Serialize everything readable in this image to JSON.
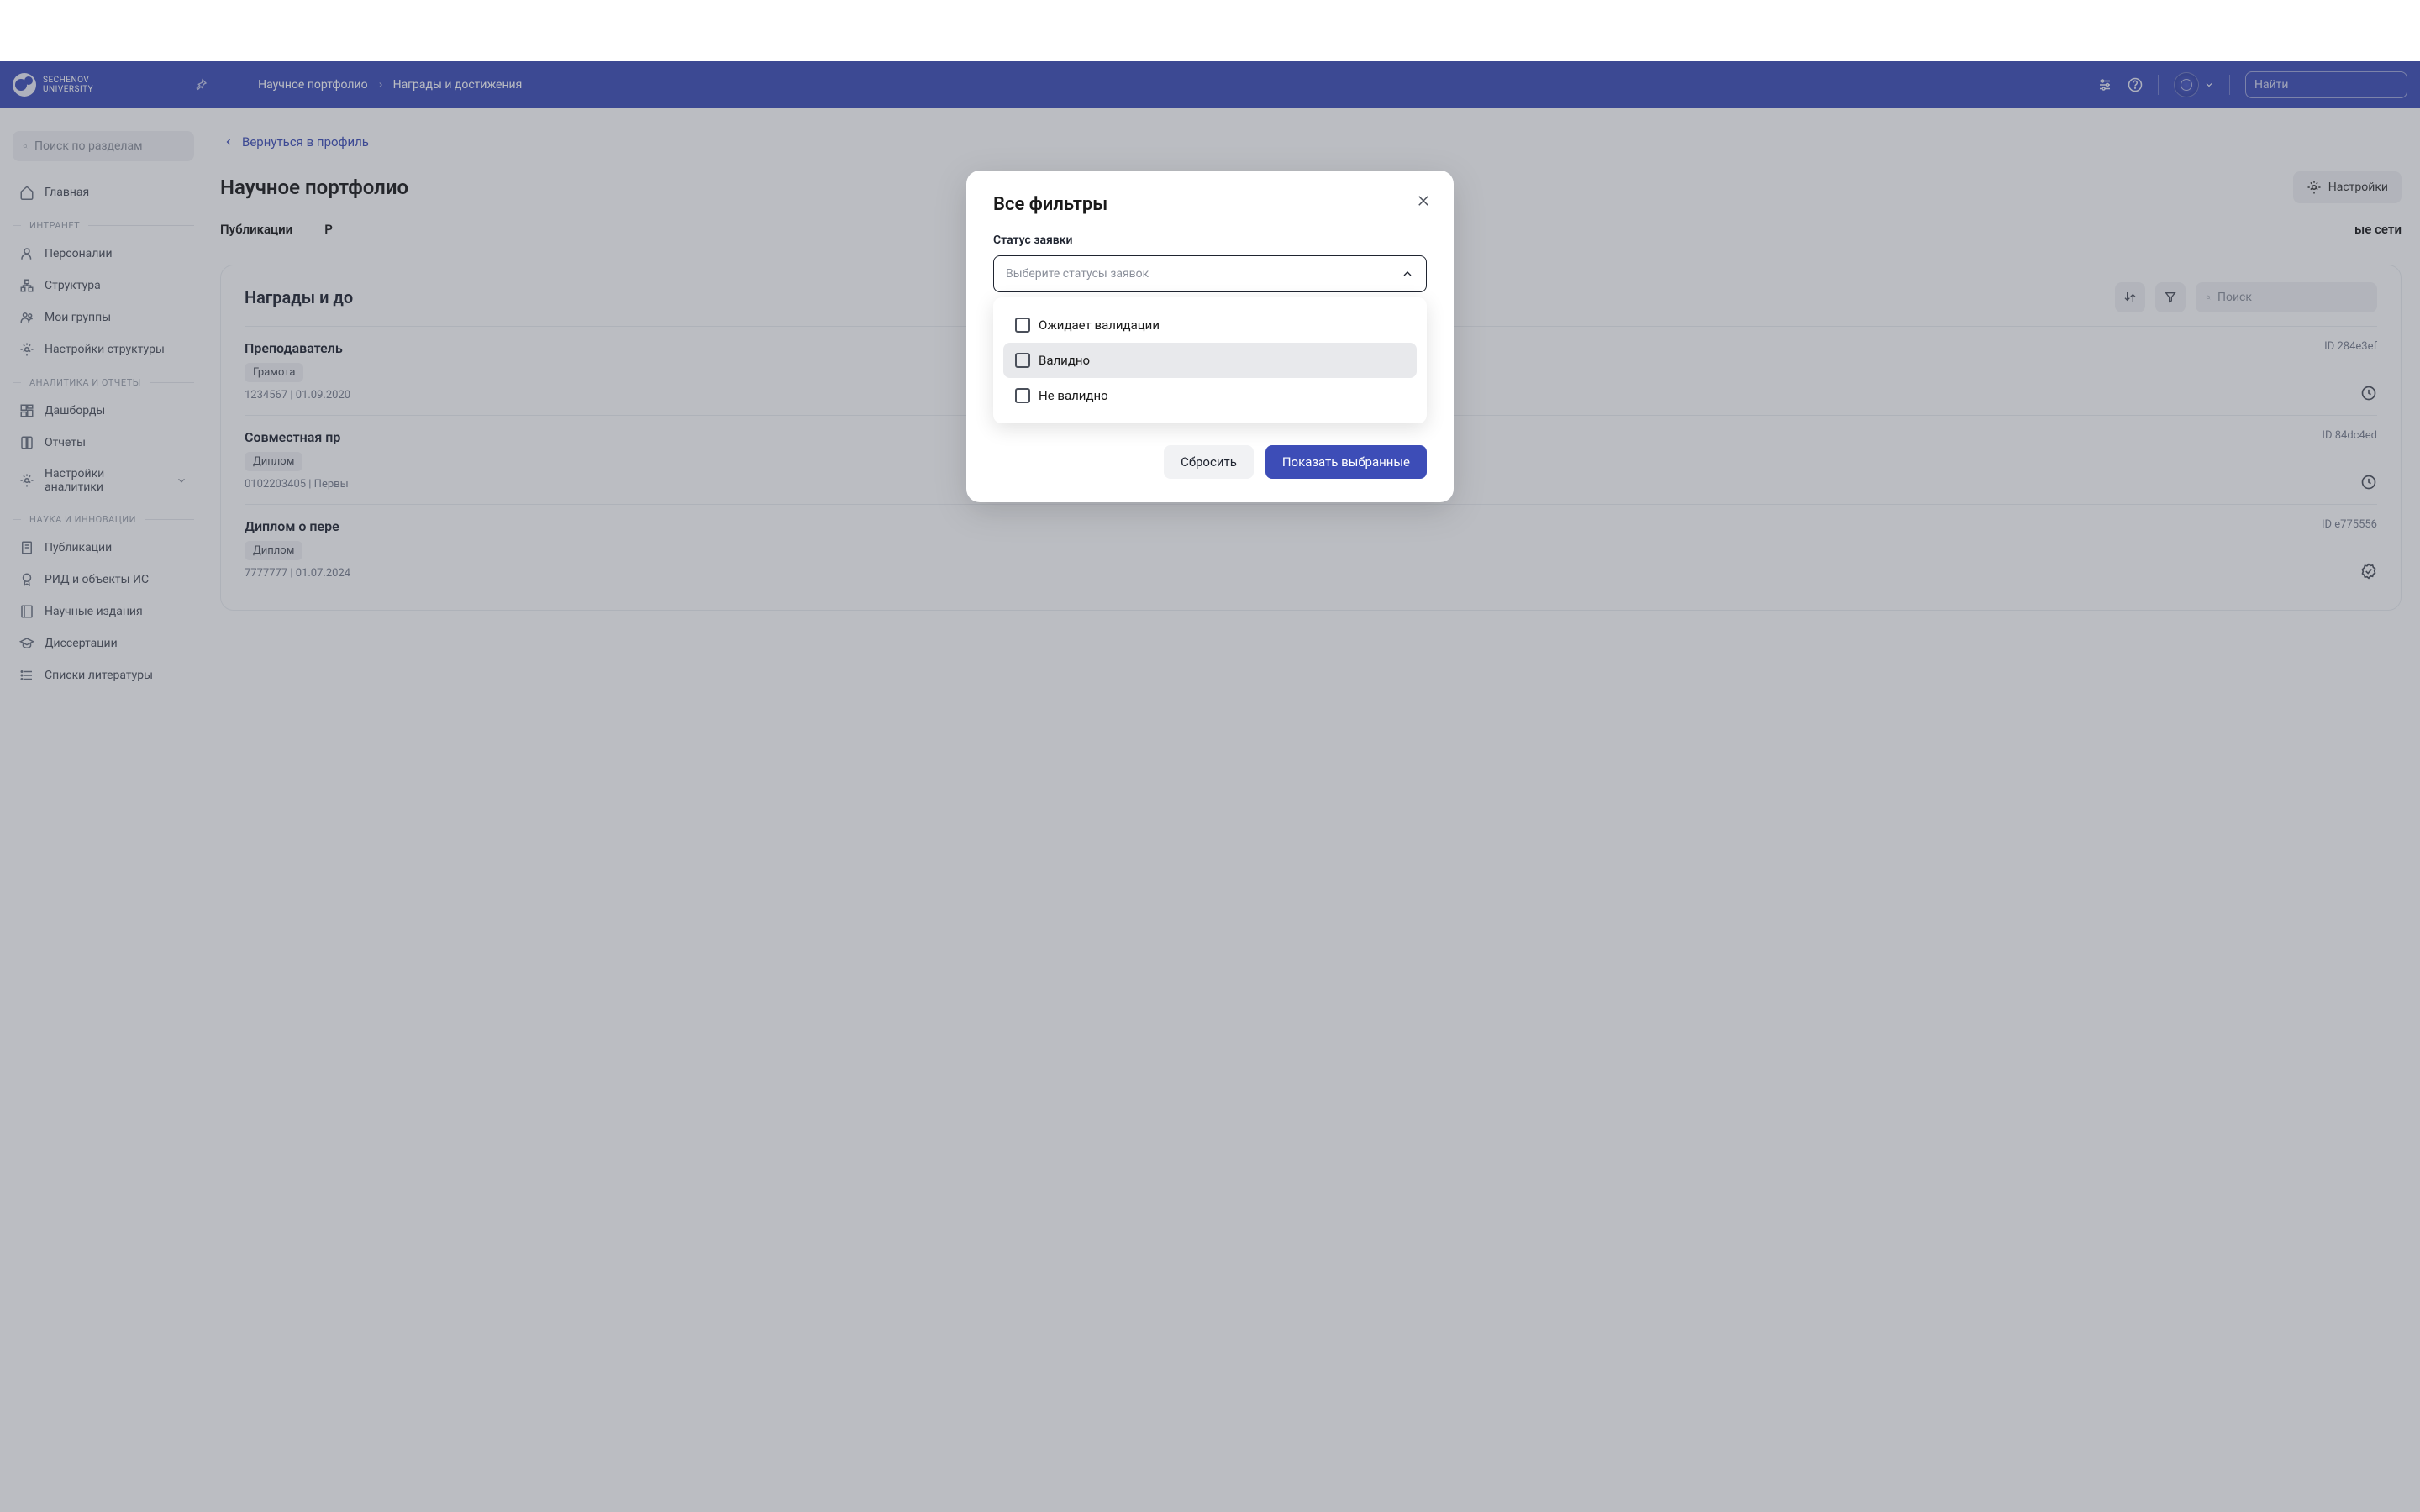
{
  "brand": {
    "line1": "SECHENOV",
    "line2": "UNIVERSITY"
  },
  "breadcrumbs": {
    "a": "Научное портфолио",
    "b": "Награды и достижения"
  },
  "topSearch": {
    "placeholder": "Найти"
  },
  "sidebar": {
    "searchPlaceholder": "Поиск по разделам",
    "home": "Главная",
    "sections": {
      "intranet": "ИНТРАНЕТ",
      "analytics": "АНАЛИТИКА И ОТЧЕТЫ",
      "science": "НАУКА И ИННОВАЦИИ"
    },
    "items": {
      "personnel": "Персоналии",
      "structure": "Структура",
      "groups": "Мои группы",
      "structSettings": "Настройки структуры",
      "dashboards": "Дашборды",
      "reports": "Отчеты",
      "analyticsSettings": "Настройки аналитики",
      "publications": "Публикации",
      "rid": "РИД и объекты ИС",
      "journals": "Научные издания",
      "dissertations": "Диссертации",
      "bibliographies": "Списки литературы"
    }
  },
  "main": {
    "backlink": "Вернуться в профиль",
    "title": "Научное портфолио",
    "settings": "Настройки",
    "tabs": {
      "a": "Публикации",
      "b": "Р",
      "c": "ые сети"
    },
    "cardTitle": "Награды и до",
    "cardSearchPlaceholder": "Поиск"
  },
  "rows": [
    {
      "title": "Преподаватель",
      "badge": "Грамота",
      "meta": "1234567 | 01.09.2020",
      "id": "ID 284e3ef",
      "status": "pending"
    },
    {
      "title": "Совместная пр",
      "badge": "Диплом",
      "meta": "0102203405 | Первы",
      "id": "ID 84dc4ed",
      "status": "pending"
    },
    {
      "title": "Диплом о пере",
      "badge": "Диплом",
      "meta": "7777777 | 01.07.2024",
      "id": "ID e775556",
      "status": "done"
    }
  ],
  "modal": {
    "title": "Все фильтры",
    "fieldLabel": "Статус заявки",
    "placeholder": "Выберите статусы заявок",
    "options": {
      "a": "Ожидает валидации",
      "b": "Валидно",
      "c": "Не валидно"
    },
    "reset": "Сбросить",
    "apply": "Показать выбранные"
  }
}
